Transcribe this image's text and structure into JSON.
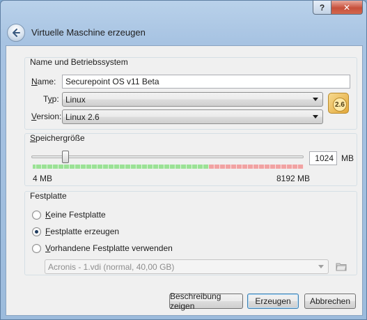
{
  "window": {
    "title": "Virtuelle Maschine erzeugen",
    "help_glyph": "?",
    "close_glyph": "✕"
  },
  "name_os": {
    "group_label": "Name und Betriebssystem",
    "name_label_underline": "N",
    "name_label_rest": "ame:",
    "name_value": "Securepoint OS v11 Beta",
    "type_label_prefix": "T",
    "type_label_underline": "y",
    "type_label_rest": "p:",
    "type_value": "Linux",
    "version_label_underline": "V",
    "version_label_rest": "ersion:",
    "version_value": "Linux 2.6",
    "os_badge": "2.6"
  },
  "memory": {
    "group_label_underline": "S",
    "group_label_rest": "peichergröße",
    "value": "1024",
    "unit": "MB",
    "min_label": "4 MB",
    "max_label": "8192 MB",
    "slider_fraction": 0.125
  },
  "disk": {
    "group_label": "Festplatte",
    "options": [
      {
        "underline": "K",
        "rest": "eine Festplatte",
        "selected": false
      },
      {
        "underline": "F",
        "rest": "estplatte erzeugen",
        "selected": true
      },
      {
        "underline": "V",
        "rest": "orhandene Festplatte verwenden",
        "selected": false
      }
    ],
    "existing_disk": "Acronis - 1.vdi (normal, 40,00 GB)"
  },
  "buttons": {
    "description": "Beschreibung zeigen",
    "create": "Erzeugen",
    "cancel": "Abbrechen"
  },
  "colors": {
    "accent_blue": "#3c7fb1",
    "scale_green": "#9be296",
    "scale_red": "#f1a3a3",
    "close_red": "#c7503b"
  },
  "icons": {
    "back": "back-arrow-icon",
    "os": "linux-os-icon",
    "folder": "folder-open-icon"
  }
}
